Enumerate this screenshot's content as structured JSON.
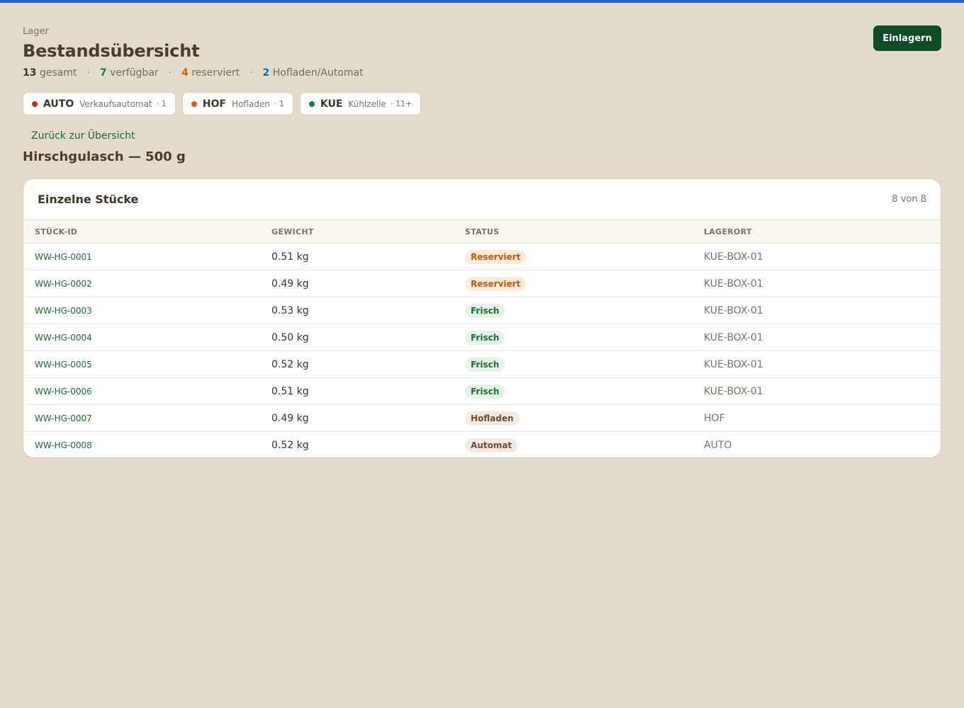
{
  "header": {
    "breadcrumb": "Lager",
    "title": "Bestandsübersicht",
    "primary_action": "Einlagern"
  },
  "stats": {
    "total_count": "13",
    "total_label": "gesamt",
    "available_count": "7",
    "available_label": "verfügbar",
    "reserved_count": "4",
    "reserved_label": "reserviert",
    "hof_count": "2",
    "hof_label": "Hofladen/Automat",
    "separator": "·",
    "colors": {
      "total": "#3b3428",
      "available": "#257a3e",
      "reserved": "#d8620a",
      "hof": "#1f66c1"
    }
  },
  "locations": [
    {
      "code": "AUTO",
      "name": "Verkaufsautomat",
      "count": "· 1",
      "color": "#b8312f"
    },
    {
      "code": "HOF",
      "name": "Hofladen",
      "count": "· 1",
      "color": "#d8620a"
    },
    {
      "code": "KUE",
      "name": "Kühlzelle",
      "count": "· 11+",
      "color": "#257a3e"
    }
  ],
  "back_link": "Zurück zur Übersicht",
  "product_title": "Hirschgulasch — 500 g",
  "table": {
    "title": "Einzelne Stücke",
    "count_label": "8 von 8",
    "columns": [
      "STÜCK-ID",
      "GEWICHT",
      "STATUS",
      "LAGERORT"
    ],
    "rows": [
      {
        "id": "WW-HG-0001",
        "weight": "0.51 kg",
        "status": "Reserviert",
        "status_type": "reserved",
        "location": "KUE-BOX-01"
      },
      {
        "id": "WW-HG-0002",
        "weight": "0.49 kg",
        "status": "Reserviert",
        "status_type": "reserved",
        "location": "KUE-BOX-01"
      },
      {
        "id": "WW-HG-0003",
        "weight": "0.53 kg",
        "status": "Frisch",
        "status_type": "fresh",
        "location": "KUE-BOX-01"
      },
      {
        "id": "WW-HG-0004",
        "weight": "0.50 kg",
        "status": "Frisch",
        "status_type": "fresh",
        "location": "KUE-BOX-01"
      },
      {
        "id": "WW-HG-0005",
        "weight": "0.52 kg",
        "status": "Frisch",
        "status_type": "fresh",
        "location": "KUE-BOX-01"
      },
      {
        "id": "WW-HG-0006",
        "weight": "0.51 kg",
        "status": "Frisch",
        "status_type": "fresh",
        "location": "KUE-BOX-01"
      },
      {
        "id": "WW-HG-0007",
        "weight": "0.49 kg",
        "status": "Hofladen",
        "status_type": "shop",
        "location": "HOF"
      },
      {
        "id": "WW-HG-0008",
        "weight": "0.52 kg",
        "status": "Automat",
        "status_type": "shop",
        "location": "AUTO"
      }
    ]
  },
  "badge_colors": {
    "reserved": {
      "bg": "#fdecd9",
      "fg": "#c8570b"
    },
    "fresh": {
      "bg": "#e3f3e6",
      "fg": "#1e6b38"
    },
    "shop": {
      "bg": "#f3ebe1",
      "fg": "#7a4a2a"
    }
  }
}
